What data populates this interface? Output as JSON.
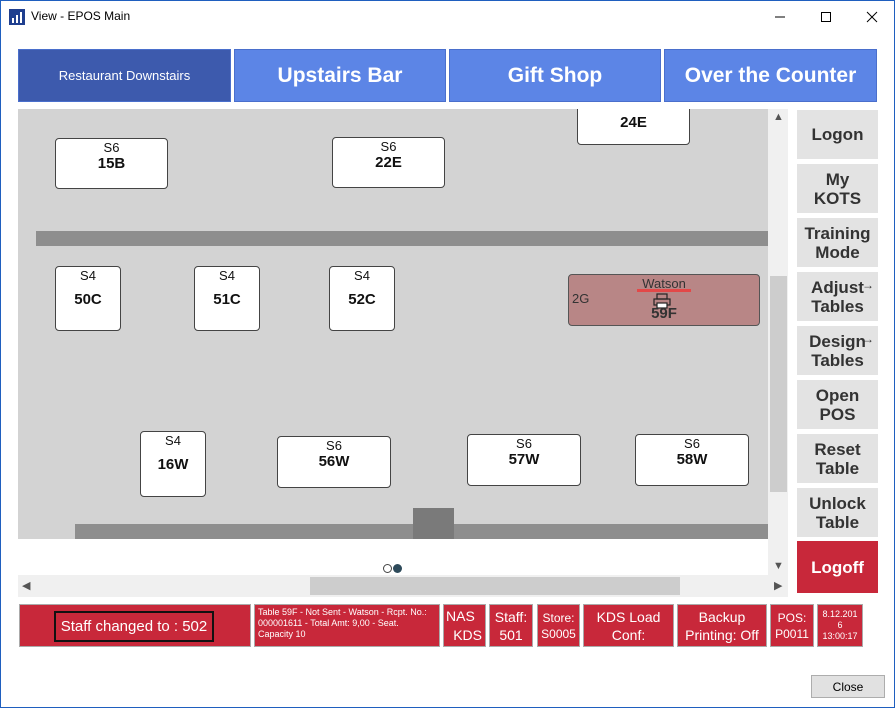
{
  "window": {
    "title": "View - EPOS Main",
    "icon": "bar-chart-icon"
  },
  "tabs": [
    {
      "label": "Restaurant Downstairs",
      "active": true
    },
    {
      "label": "Upstairs Bar",
      "active": false
    },
    {
      "label": "Gift Shop",
      "active": false
    },
    {
      "label": "Over the Counter",
      "active": false
    }
  ],
  "tables": [
    {
      "seats": "S6",
      "name": "15B"
    },
    {
      "seats": "S6",
      "name": "22E"
    },
    {
      "seats": "",
      "name": "24E"
    },
    {
      "seats": "S4",
      "name": "50C"
    },
    {
      "seats": "S4",
      "name": "51C"
    },
    {
      "seats": "S4",
      "name": "52C"
    },
    {
      "seats": "S4",
      "name": "16W"
    },
    {
      "seats": "S6",
      "name": "56W"
    },
    {
      "seats": "S6",
      "name": "57W"
    },
    {
      "seats": "S6",
      "name": "58W"
    }
  ],
  "occupied_table": {
    "customer": "Watson",
    "covers": "2G",
    "name": "59F",
    "icon": "printer-icon"
  },
  "side_buttons": [
    {
      "line1": "Logon",
      "line2": ""
    },
    {
      "line1": "My",
      "line2": "KOTS"
    },
    {
      "line1": "Training",
      "line2": "Mode"
    },
    {
      "line1": "Adjust",
      "line2": "Tables",
      "arrow": "→"
    },
    {
      "line1": "Design",
      "line2": "Tables",
      "arrow": "→"
    },
    {
      "line1": "Open",
      "line2": "POS"
    },
    {
      "line1": "Reset",
      "line2": "Table"
    },
    {
      "line1": "Unlock",
      "line2": "Table"
    },
    {
      "line1": "Logoff",
      "line2": ""
    }
  ],
  "status": {
    "staff_changed": "Staff changed to : 502",
    "table_info": "Table 59F - Not Sent - Watson - Rcpt. No.: 000001611 - Total Amt:  9,00 - Seat. Capacity 10",
    "nas_l1": "NAS",
    "nas_l2": "KDS",
    "staff_l1": "Staff:",
    "staff_l2": "501",
    "store_l1": "Store:",
    "store_l2": "S0005",
    "kds_l1": "KDS Load",
    "kds_l2": "Conf:",
    "backup_l1": "Backup",
    "backup_l2": "Printing: Off",
    "pos_l1": "POS:",
    "pos_l2": "P0011",
    "date_l1": "8.12.201",
    "date_l2": "6",
    "date_l3": "13:00:17"
  },
  "close_label": "Close",
  "colors": {
    "tab": "#5c85e6",
    "tab_active": "#3d5aad",
    "status_red": "#c8283a",
    "occupied": "#b88686"
  }
}
